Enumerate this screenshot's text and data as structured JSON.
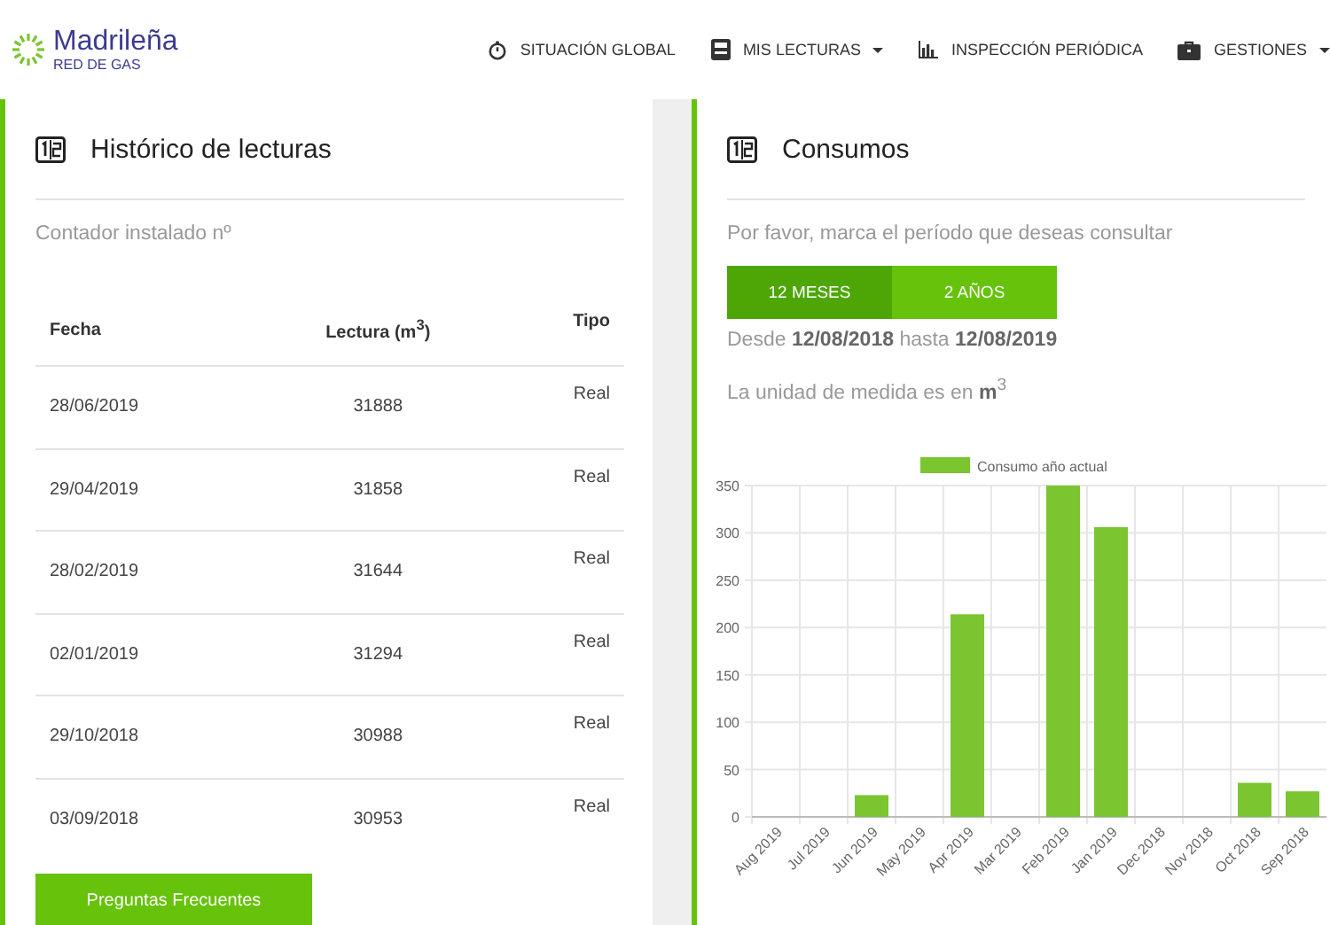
{
  "header": {
    "logo": {
      "name": "Madrileña",
      "tagline": "RED DE GAS"
    },
    "nav": [
      {
        "label": "SITUACIÓN GLOBAL",
        "kind": "timer",
        "dropdown": false
      },
      {
        "label": "MIS LECTURAS",
        "kind": "meter",
        "dropdown": true
      },
      {
        "label": "INSPECCIÓN PERIÓDICA",
        "kind": "bars",
        "dropdown": false
      },
      {
        "label": "GESTIONES",
        "kind": "briefcase",
        "dropdown": true
      }
    ]
  },
  "history": {
    "title": "Histórico de lecturas",
    "meter_label": "Contador instalado nº",
    "table": {
      "columns": [
        "Fecha",
        "Lectura (m$^{3}$)",
        "Tipo"
      ],
      "rows": [
        [
          "28/06/2019",
          "31888",
          "Real"
        ],
        [
          "29/04/2019",
          "31858",
          "Real"
        ],
        [
          "28/02/2019",
          "31644",
          "Real"
        ],
        [
          "02/01/2019",
          "31294",
          "Real"
        ],
        [
          "29/10/2018",
          "30988",
          "Real"
        ],
        [
          "03/09/2018",
          "30953",
          "Real"
        ]
      ]
    },
    "faq_button": "Preguntas Frecuentes"
  },
  "consumption": {
    "title": "Consumos",
    "prompt": "Por favor, marca el período que deseas consultar",
    "periods": [
      {
        "label": "12 MESES",
        "selected": true
      },
      {
        "label": "2 AÑOS",
        "selected": false
      }
    ],
    "range": "Desde **12/08/2018** hasta **12/08/2019**",
    "unit": "La unidad de medida es en **m**$^{3}$",
    "chart_data": {
      "type": "bar",
      "categories": [
        "Aug 2019",
        "Jul 2019",
        "Jun 2019",
        "May 2019",
        "Apr 2019",
        "Mar 2019",
        "Feb 2019",
        "Jan 2019",
        "Dec 2018",
        "Nov 2018",
        "Oct 2018",
        "Sep 2018"
      ],
      "series": [
        {
          "name": "Consumo año actual",
          "color": "#7ac530",
          "values": [
            0,
            0,
            23,
            0,
            214,
            0,
            350,
            306,
            0,
            0,
            36,
            27
          ]
        }
      ],
      "grid": true,
      "ylim": [
        0,
        350
      ],
      "yticks": [
        0,
        50,
        100,
        150,
        200,
        250,
        300,
        350
      ]
    }
  }
}
